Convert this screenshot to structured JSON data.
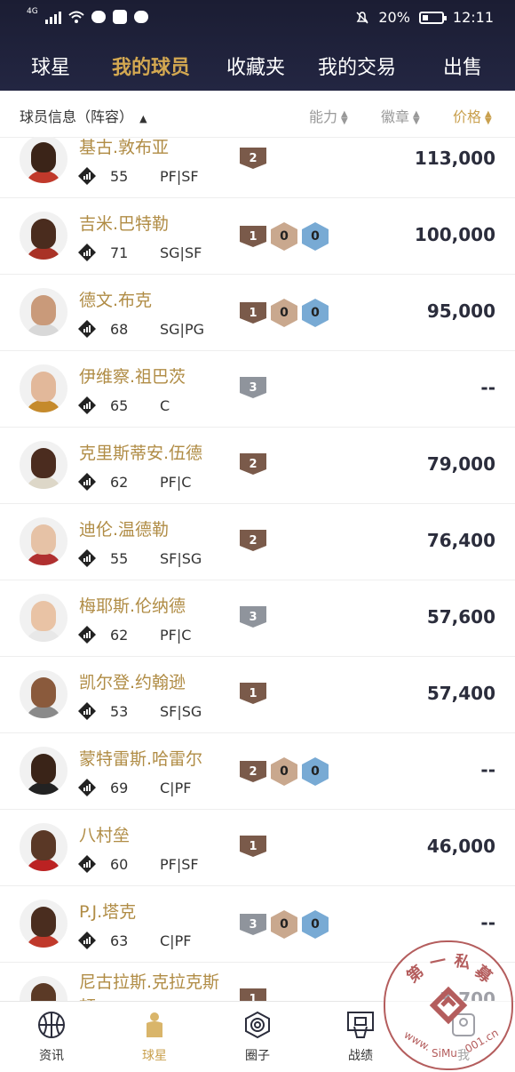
{
  "status_bar": {
    "network": "4G",
    "battery_percent": "20%",
    "time": "12:11"
  },
  "top_tabs": [
    {
      "label": "球星",
      "active": false
    },
    {
      "label": "我的球员",
      "active": true
    },
    {
      "label": "收藏夹",
      "active": false
    },
    {
      "label": "我的交易",
      "active": false
    },
    {
      "label": "出售",
      "active": false
    }
  ],
  "filter_bar": {
    "info_label": "球员信息（阵容）",
    "sort_ability": "能力",
    "sort_badge": "徽章",
    "sort_price": "价格"
  },
  "players": [
    {
      "name": "基古.敦布亚",
      "ovr": "55",
      "pos": "PF|SF",
      "tag": "2",
      "tag_color": "brown",
      "hex": [],
      "price": "113,000"
    },
    {
      "name": "吉米.巴特勒",
      "ovr": "71",
      "pos": "SG|SF",
      "tag": "1",
      "tag_color": "brown",
      "hex": [
        "0",
        "0"
      ],
      "price": "100,000"
    },
    {
      "name": "德文.布克",
      "ovr": "68",
      "pos": "SG|PG",
      "tag": "1",
      "tag_color": "brown",
      "hex": [
        "0",
        "0"
      ],
      "price": "95,000"
    },
    {
      "name": "伊维察.祖巴茨",
      "ovr": "65",
      "pos": "C",
      "tag": "3",
      "tag_color": "gray",
      "hex": [],
      "price": "--"
    },
    {
      "name": "克里斯蒂安.伍德",
      "ovr": "62",
      "pos": "PF|C",
      "tag": "2",
      "tag_color": "brown",
      "hex": [],
      "price": "79,000"
    },
    {
      "name": "迪伦.温德勒",
      "ovr": "55",
      "pos": "SF|SG",
      "tag": "2",
      "tag_color": "brown",
      "hex": [],
      "price": "76,400"
    },
    {
      "name": "梅耶斯.伦纳德",
      "ovr": "62",
      "pos": "PF|C",
      "tag": "3",
      "tag_color": "gray",
      "hex": [],
      "price": "57,600"
    },
    {
      "name": "凯尔登.约翰逊",
      "ovr": "53",
      "pos": "SF|SG",
      "tag": "1",
      "tag_color": "brown",
      "hex": [],
      "price": "57,400"
    },
    {
      "name": "蒙特雷斯.哈雷尔",
      "ovr": "69",
      "pos": "C|PF",
      "tag": "2",
      "tag_color": "brown",
      "hex": [
        "0",
        "0"
      ],
      "price": "--"
    },
    {
      "name": "八村垒",
      "ovr": "60",
      "pos": "PF|SF",
      "tag": "1",
      "tag_color": "brown",
      "hex": [],
      "price": "46,000"
    },
    {
      "name": "P.J.塔克",
      "ovr": "63",
      "pos": "C|PF",
      "tag": "3",
      "tag_color": "gray",
      "hex": [
        "0",
        "0"
      ],
      "price": "--"
    },
    {
      "name": "尼古拉斯.克拉克斯",
      "name_line2": "顿",
      "ovr": "",
      "pos": "",
      "tag": "1",
      "tag_color": "brown",
      "hex": [],
      "price": "3,700"
    }
  ],
  "bottom_nav": [
    {
      "label": "资讯",
      "icon": "basketball-icon",
      "active": false
    },
    {
      "label": "球星",
      "icon": "player-jersey-icon",
      "active": true
    },
    {
      "label": "圈子",
      "icon": "circle-hex-icon",
      "active": false
    },
    {
      "label": "战绩",
      "icon": "hoop-icon",
      "active": false
    },
    {
      "label": "我",
      "icon": "profile-icon",
      "active": false
    }
  ],
  "watermark": {
    "text": "第一私募",
    "url": "www.SiMu001.cn"
  }
}
